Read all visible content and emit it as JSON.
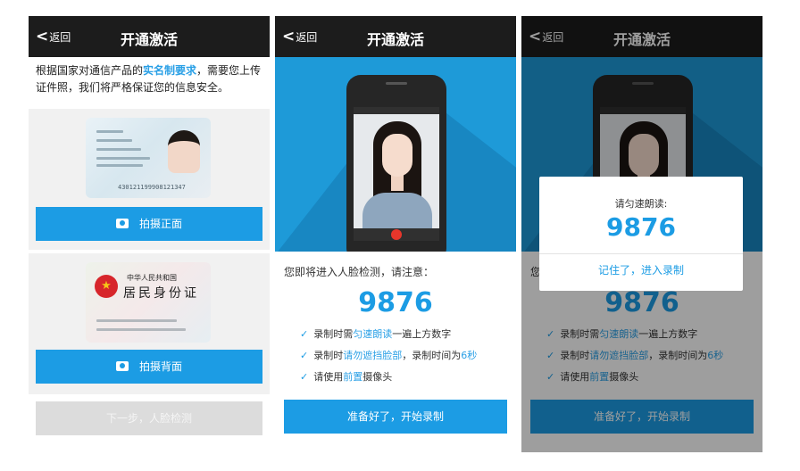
{
  "navbar": {
    "back_label": "返回",
    "title": "开通激活"
  },
  "screen1": {
    "intro_pre": "根据国家对通信产品的",
    "intro_link": "实名制要求",
    "intro_post": "，需要您上传证件照，我们将严格保证您的信息安全。",
    "front_card_number": "430121199908121347",
    "back_card_title_small": "中华人民共和国",
    "back_card_title_large": "居民身份证",
    "btn_front": "拍摄正面",
    "btn_back": "拍摄背面",
    "btn_next": "下一步，人脸检测"
  },
  "screen2": {
    "notice": "您即将进入人脸检测，请注意：",
    "number": "9876",
    "rules": [
      {
        "pre": "录制时需",
        "hl": "匀速朗读",
        "post": "一遍上方数字"
      },
      {
        "pre": "录制时",
        "hl": "请勿遮挡脸部",
        "post": "，录制时间为",
        "hl2": "6秒"
      },
      {
        "pre": "请使用",
        "hl": "前置",
        "post": "摄像头"
      }
    ],
    "btn_start": "准备好了，开始录制"
  },
  "screen3": {
    "modal_title": "请匀速朗读:",
    "modal_number": "9876",
    "modal_button": "记住了，进入录制"
  },
  "colors": {
    "accent": "#1c9ce4",
    "navbar": "#1c1c1c",
    "banner": "#1e9ad8",
    "disabled": "#dcdcdc"
  }
}
